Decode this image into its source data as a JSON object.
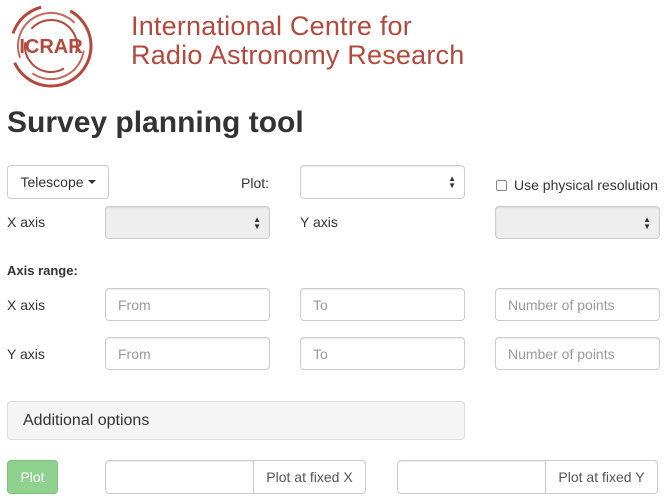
{
  "header": {
    "logo_text": "ICRAR",
    "org_line1": "International Centre for",
    "org_line2": "Radio Astronomy Research"
  },
  "page_title": "Survey planning tool",
  "controls": {
    "telescope_button": "Telescope",
    "plot_label": "Plot:",
    "plot_select_value": "",
    "physical_resolution_label": "Use physical resolution",
    "x_axis_label": "X axis",
    "y_axis_label": "Y axis"
  },
  "axis_range": {
    "heading": "Axis range:",
    "x_label": "X axis",
    "y_label": "Y axis",
    "from_placeholder": "From",
    "to_placeholder": "To",
    "points_placeholder": "Number of points"
  },
  "additional_options": "Additional options",
  "actions": {
    "plot_button": "Plot",
    "plot_fixed_x": "Plot at fixed X",
    "plot_fixed_y": "Plot at fixed Y"
  },
  "colors": {
    "brand": "#b04a3f",
    "success": "#8fd18f"
  }
}
